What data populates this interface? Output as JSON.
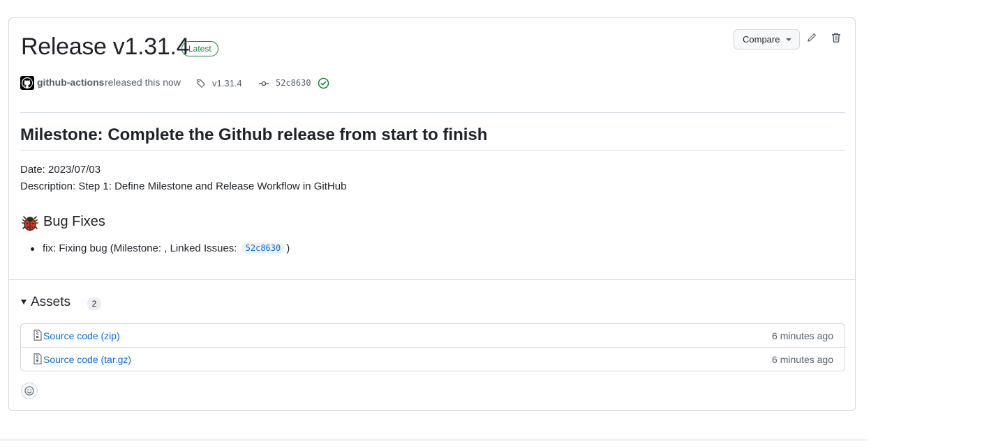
{
  "release": {
    "title": "Release v1.31.4",
    "badge": "Latest",
    "compare_label": "Compare",
    "edit_icon": "pencil-icon",
    "delete_icon": "trash-icon",
    "author": "github-actions",
    "released_text": "released this now",
    "tag": "v1.31.4",
    "commit": "52c8630",
    "status": "verified"
  },
  "body": {
    "milestone_heading": "Milestone: Complete the Github release from start to finish",
    "date_line": "Date: 2023/07/03",
    "description_line": "Description: Step 1: Define Milestone and Release Workflow in GitHub",
    "bug_section_title": "Bug Fixes",
    "fix_prefix": "fix: Fixing bug (Milestone: , Linked Issues:",
    "fix_commit": "52c8630",
    "fix_suffix": ")"
  },
  "assets": {
    "title": "Assets",
    "count": "2",
    "items": [
      {
        "label": "Source code",
        "ext": "(zip)",
        "time": "6 minutes ago"
      },
      {
        "label": "Source code",
        "ext": "(tar.gz)",
        "time": "6 minutes ago"
      }
    ]
  },
  "colors": {
    "accent": "#0969da",
    "success": "#1a7f37",
    "border": "#d0d7de",
    "text": "#1f2328",
    "muted": "#57606a"
  }
}
